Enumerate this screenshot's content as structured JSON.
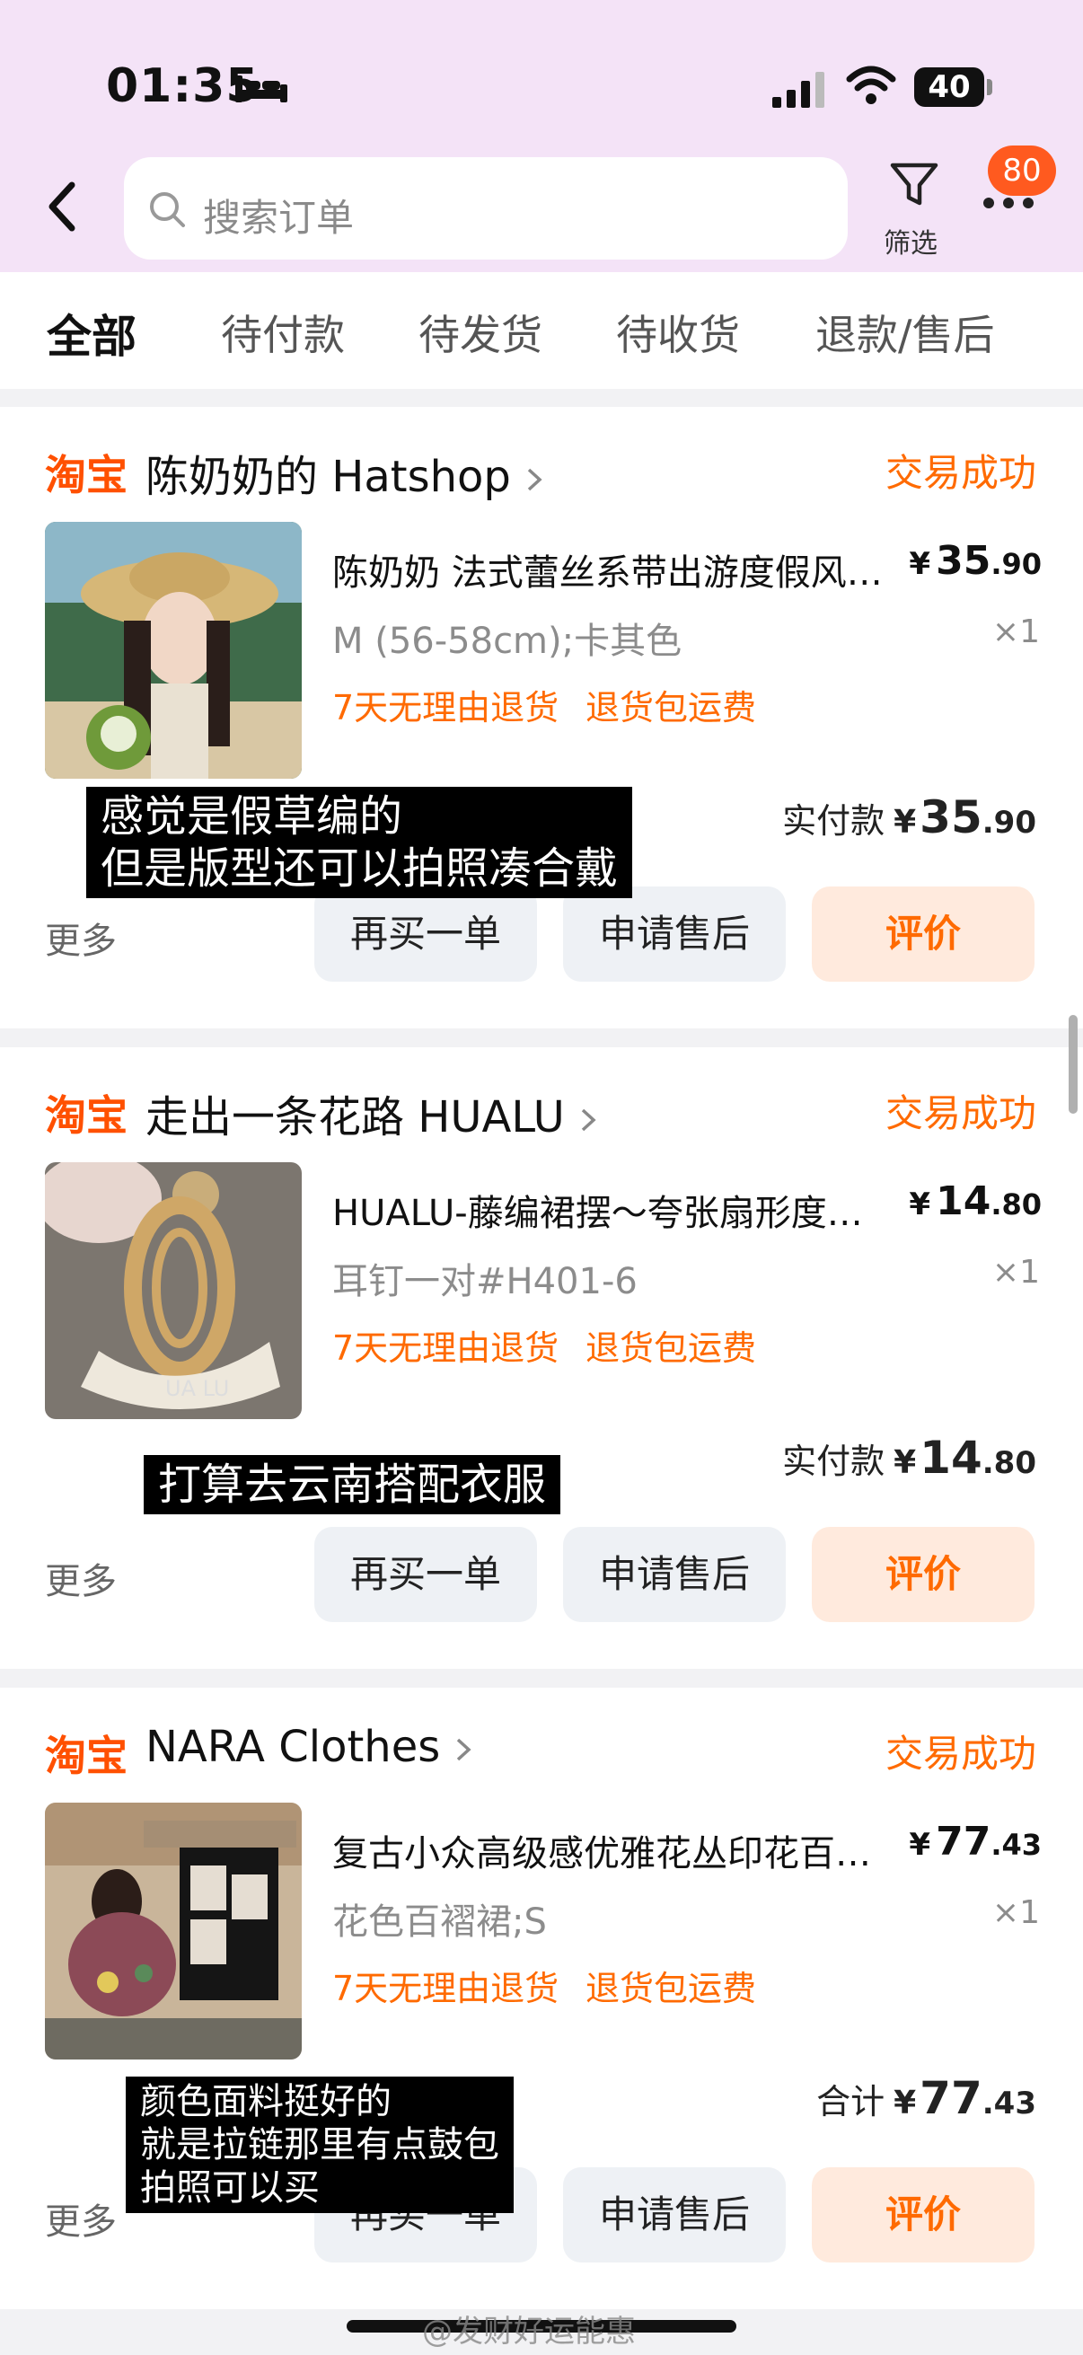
{
  "status_bar": {
    "time": "01:35",
    "battery": "40"
  },
  "header": {
    "search_placeholder": "搜索订单",
    "filter_label": "筛选",
    "badge_count": "80"
  },
  "tabs": [
    "全部",
    "待付款",
    "待发货",
    "待收货",
    "退款/售后"
  ],
  "orders": [
    {
      "platform": "淘宝",
      "shop": "陈奶奶的 Hatshop",
      "status": "交易成功",
      "title": "陈奶奶 法式蕾丝系带出游度假风…",
      "price_yen": "¥",
      "price_int": "35",
      "price_dec": ".90",
      "sku": "M (56-58cm);卡其色",
      "qty": "×1",
      "tag1": "7天无理由退货",
      "tag2": "退货包运费",
      "paid_label": "实付款",
      "paid_int": "35",
      "paid_dec": ".90",
      "more": "更多",
      "btn_rebuy": "再买一单",
      "btn_after": "申请售后",
      "btn_review": "评价",
      "caption": [
        "感觉是假草编的",
        "但是版型还可以拍照凑合戴"
      ]
    },
    {
      "platform": "淘宝",
      "shop": "走出一条花路 HUALU",
      "status": "交易成功",
      "title": "HUALU-藤编裙摆～夸张扇形度…",
      "price_yen": "¥",
      "price_int": "14",
      "price_dec": ".80",
      "sku": "耳钉一对#H401-6",
      "qty": "×1",
      "tag1": "7天无理由退货",
      "tag2": "退货包运费",
      "paid_label": "实付款",
      "paid_int": "14",
      "paid_dec": ".80",
      "more": "更多",
      "btn_rebuy": "再买一单",
      "btn_after": "申请售后",
      "btn_review": "评价",
      "caption": [
        "打算去云南搭配衣服"
      ],
      "image_text": "UA LU"
    },
    {
      "platform": "淘宝",
      "shop": "NARA Clothes",
      "status": "交易成功",
      "title": "复古小众高级感优雅花丛印花百…",
      "price_yen": "¥",
      "price_int": "77",
      "price_dec": ".43",
      "sku": "花色百褶裙;S",
      "qty": "×1",
      "tag1": "7天无理由退货",
      "tag2": "退货包运费",
      "paid_label": "合计",
      "paid_int": "77",
      "paid_dec": ".43",
      "more": "更多",
      "btn_rebuy": "再买一单",
      "btn_after": "申请售后",
      "btn_review": "评价",
      "caption": [
        "颜色面料挺好的",
        "就是拉链那里有点鼓包",
        "拍照可以买"
      ]
    }
  ],
  "watermark": "@发财好运能惠",
  "colors": {
    "accent": "#ff6a00",
    "header_bg": "#f4e3f7",
    "badge": "#ff5a1f"
  }
}
